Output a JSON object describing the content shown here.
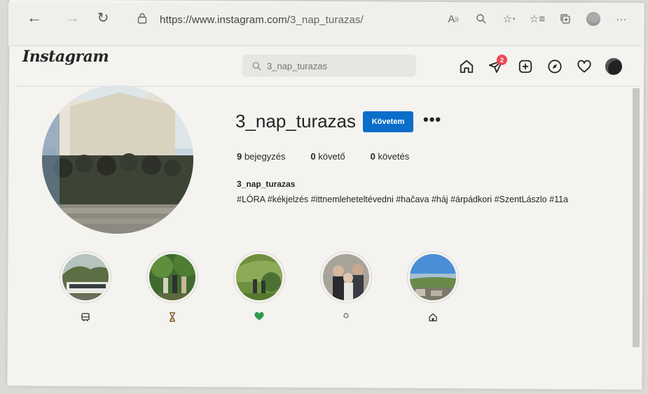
{
  "browser": {
    "url_host": "https://www.instagram.com/",
    "url_path": "3_nap_turazas/",
    "back_icon": "arrow-left-icon",
    "forward_icon": "arrow-right-icon",
    "refresh_icon": "refresh-icon",
    "toolbar_icons": [
      "read-aloud-icon",
      "zoom-icon",
      "favorite-add-icon",
      "favorites-icon",
      "collections-icon",
      "profile-icon",
      "more-icon"
    ]
  },
  "instagram": {
    "logo": "Instagram",
    "search": {
      "placeholder": "3_nap_turazas",
      "value": "3_nap_turazas"
    },
    "nav": {
      "icons": [
        "home-icon",
        "messenger-icon",
        "new-post-icon",
        "explore-icon",
        "activity-heart-icon",
        "avatar-icon"
      ],
      "messages_badge": "2"
    }
  },
  "profile": {
    "username": "3_nap_turazas",
    "follow_label": "Követem",
    "more_label": "•••",
    "posts_count": "9",
    "posts_label": "bejegyzés",
    "followers_count": "0",
    "followers_label": "követő",
    "following_count": "0",
    "following_label": "követés",
    "bio_name": "3_nap_turazas",
    "bio_text": "#LÓRA #kékjelzés #ittnemleheteltévedni #hačava #háj #árpádkori #SzentLászlo #11a"
  },
  "highlights": [
    {
      "label_icon": "bus-icon",
      "label_glyph": "🚌"
    },
    {
      "label_icon": "hourglass-icon",
      "label_glyph": "⏳"
    },
    {
      "label_icon": "green-heart-icon",
      "label_glyph": "♥"
    },
    {
      "label_icon": "small-circle-icon",
      "label_glyph": "○"
    },
    {
      "label_icon": "house-icon",
      "label_glyph": "⌂"
    }
  ],
  "colors": {
    "follow_button": "#0a6dc9",
    "badge": "#ed4956",
    "heart_green": "#2e9a4a"
  }
}
